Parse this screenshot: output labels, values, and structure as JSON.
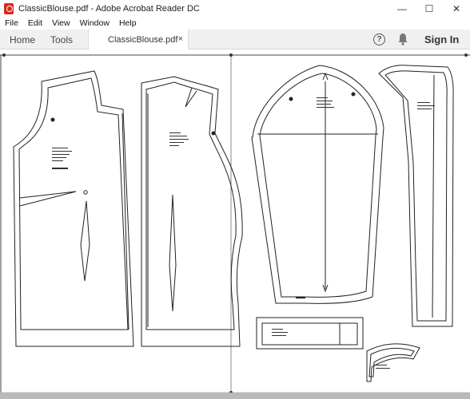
{
  "window": {
    "title": "ClassicBlouse.pdf - Adobe Acrobat Reader DC",
    "controls": {
      "minimize": "—",
      "maximize": "☐",
      "close": "✕"
    }
  },
  "menu": {
    "items": [
      "File",
      "Edit",
      "View",
      "Window",
      "Help"
    ]
  },
  "tabs": {
    "home": "Home",
    "tools": "Tools",
    "document": "ClassicBlouse.pdf",
    "close": "×"
  },
  "toolbar": {
    "help": "?",
    "sign_in": "Sign In"
  },
  "colors": {
    "acrobat_red": "#d7291e",
    "tabbar_bg": "#f0f0f0"
  },
  "icons": {
    "app": "acrobat-icon",
    "help": "help-circle-icon",
    "notifications": "bell-icon"
  }
}
